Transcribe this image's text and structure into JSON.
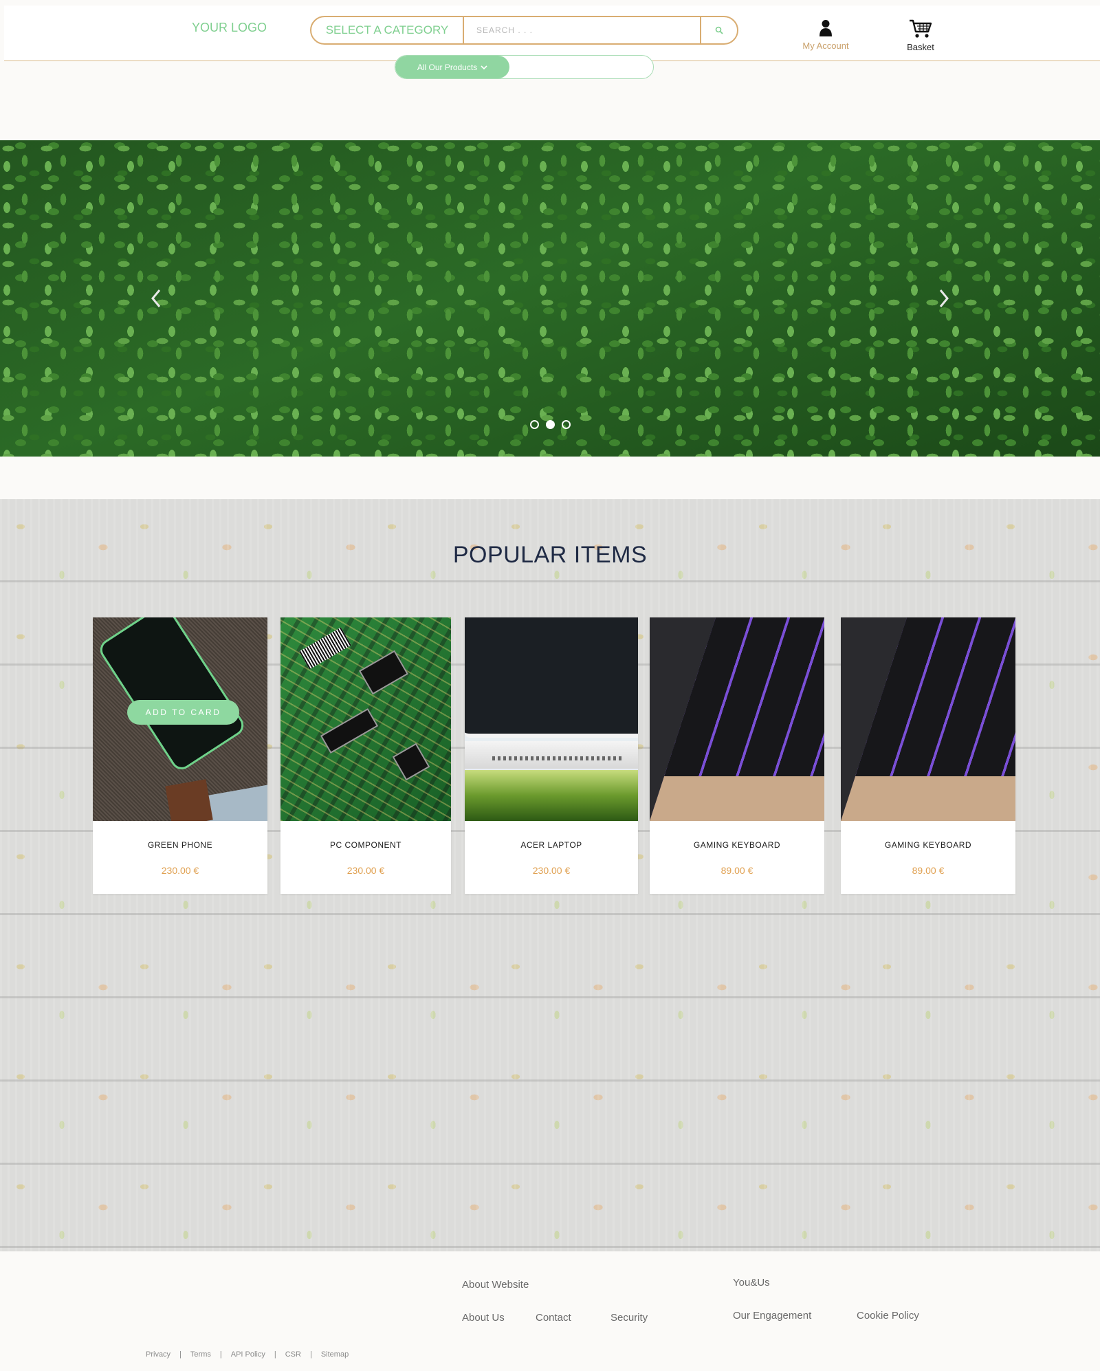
{
  "header": {
    "logo": "YOUR LOGO",
    "category_label": "SELECT A CATEGORY",
    "search_placeholder": "SEARCH . . .",
    "account_label": "My Account",
    "basket_label": "Basket",
    "products_menu": "All Our Products"
  },
  "hero": {
    "slide_count": 3,
    "active_slide": 2
  },
  "popular": {
    "title": "POPULAR ITEMS",
    "add_to_card": "ADD TO CARD",
    "items": [
      {
        "name": "GREEN PHONE",
        "price": "230.00 €"
      },
      {
        "name": "PC COMPONENT",
        "price": "230.00 €"
      },
      {
        "name": "ACER LAPTOP",
        "price": "230.00 €"
      },
      {
        "name": "GAMING KEYBOARD",
        "price": "89.00 €"
      },
      {
        "name": "GAMING KEYBOARD",
        "price": "89.00 €"
      }
    ]
  },
  "footer": {
    "col1_heading": "About Website",
    "col1_links": [
      "About Us",
      "Contact",
      "Security"
    ],
    "col2_heading": "You&Us",
    "col2_links": [
      "Our Engagement",
      "Cookie Policy"
    ],
    "bottom_links": [
      "Privacy",
      "Terms",
      "API Policy",
      "CSR",
      "Sitemap"
    ],
    "separator": "|"
  },
  "colors": {
    "accent_green": "#8ed8a0",
    "accent_gold": "#d9ad72",
    "price": "#e0a050",
    "title": "#1f2a44"
  },
  "icons": {
    "search": "search-icon",
    "account": "user-icon",
    "basket": "cart-icon",
    "dropdown": "chevron-down-icon",
    "prev": "chevron-left-icon",
    "next": "chevron-right-icon"
  }
}
